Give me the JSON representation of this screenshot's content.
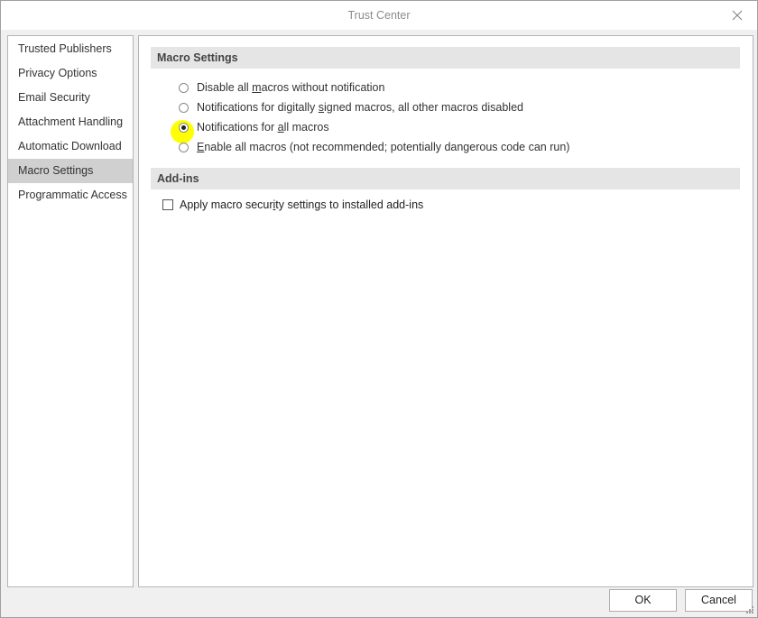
{
  "window": {
    "title": "Trust Center"
  },
  "sidebar": {
    "items": [
      {
        "label": "Trusted Publishers"
      },
      {
        "label": "Privacy Options"
      },
      {
        "label": "Email Security"
      },
      {
        "label": "Attachment Handling"
      },
      {
        "label": "Automatic Download"
      },
      {
        "label": "Macro Settings",
        "selected": true
      },
      {
        "label": "Programmatic Access"
      }
    ]
  },
  "macro_settings": {
    "header": "Macro Settings",
    "selected_index": 2,
    "options": [
      {
        "pre": "Disable all ",
        "ul": "m",
        "post": "acros without notification"
      },
      {
        "pre": "Notifications for digitally ",
        "ul": "s",
        "post": "igned macros, all other macros disabled"
      },
      {
        "pre": "Notifications for ",
        "ul": "a",
        "post": "ll macros"
      },
      {
        "pre": "",
        "ul": "E",
        "post": "nable all macros (not recommended; potentially dangerous code can run)"
      }
    ]
  },
  "addins": {
    "header": "Add-ins",
    "checkbox": {
      "pre": "Apply macro secur",
      "ul": "i",
      "post": "ty settings to installed add-ins",
      "checked": false
    }
  },
  "buttons": {
    "ok": "OK",
    "cancel": "Cancel"
  },
  "colors": {
    "highlight": "#ffff00",
    "selected_item": "#d0d0d0",
    "header_bg": "#e5e5e5"
  },
  "icons": {
    "close": "close-icon",
    "resize": "resize-grip-icon"
  }
}
